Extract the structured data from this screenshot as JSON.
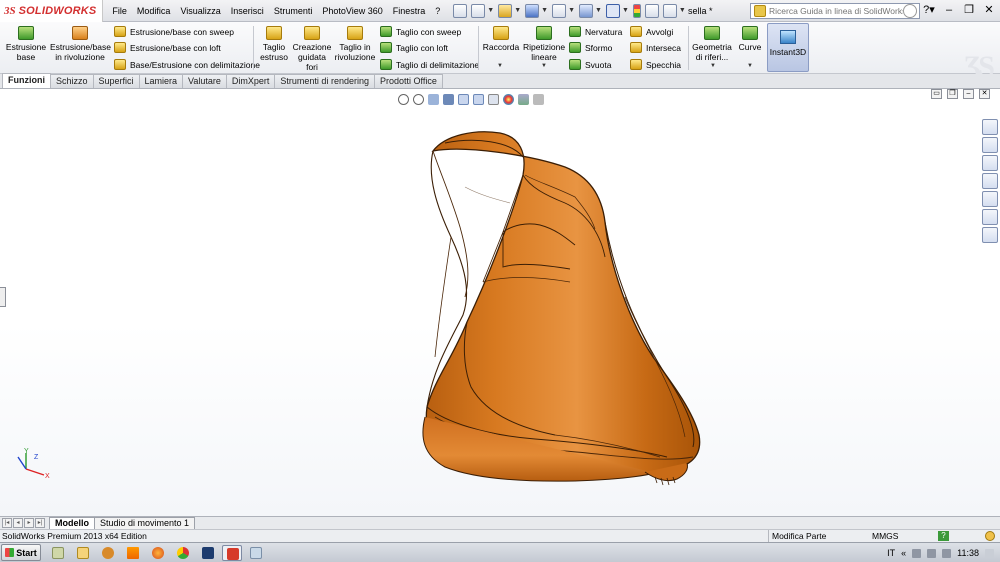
{
  "app": {
    "logo_prefix": "3S",
    "logo_name": "SOLIDWORKS",
    "document_title": "sella *"
  },
  "menu": [
    "File",
    "Modifica",
    "Visualizza",
    "Inserisci",
    "Strumenti",
    "PhotoView 360",
    "Finestra",
    "?"
  ],
  "search": {
    "placeholder": "Ricerca Guida in linea di SolidWorks"
  },
  "commands": {
    "estrusione_base": "Estrusione base",
    "estrusione_rivoluzione": "Estrusione/base in rivoluzione",
    "sweep": "Estrusione/base con sweep",
    "loft": "Estrusione/base con loft",
    "delimitazione": "Base/Estrusione con delimitazione",
    "taglio_estruso": "Taglio estruso",
    "creazione_fori": "Creazione guidata fori",
    "taglio_rivoluzione": "Taglio in rivoluzione",
    "taglio_sweep": "Taglio con sweep",
    "taglio_loft": "Taglio con loft",
    "taglio_delimitazione": "Taglio di delimitazione",
    "raccorda": "Raccorda",
    "ripetizione_lineare": "Ripetizione lineare",
    "nervatura": "Nervatura",
    "sformo": "Sformo",
    "svuota": "Svuota",
    "avvolgi": "Avvolgi",
    "interseca": "Interseca",
    "specchia": "Specchia",
    "geometria_riferimento": "Geometria di riferi...",
    "curve": "Curve",
    "instant3d": "Instant3D"
  },
  "tabs": [
    "Funzioni",
    "Schizzo",
    "Superfici",
    "Lamiera",
    "Valutare",
    "DimXpert",
    "Strumenti di rendering",
    "Prodotti Office"
  ],
  "bottom_tabs": [
    "Modello",
    "Studio di movimento 1"
  ],
  "status": {
    "edition": "SolidWorks Premium 2013 x64 Edition",
    "mode": "Modifica Parte",
    "units": "MMGS",
    "help": "?"
  },
  "taskbar": {
    "start_label": "Start",
    "language": "IT",
    "clock": "11:38"
  },
  "colors": {
    "model_orange": "#c46a14",
    "logo_red": "#d32f2f",
    "accent_blue": "#b9c6e3"
  }
}
